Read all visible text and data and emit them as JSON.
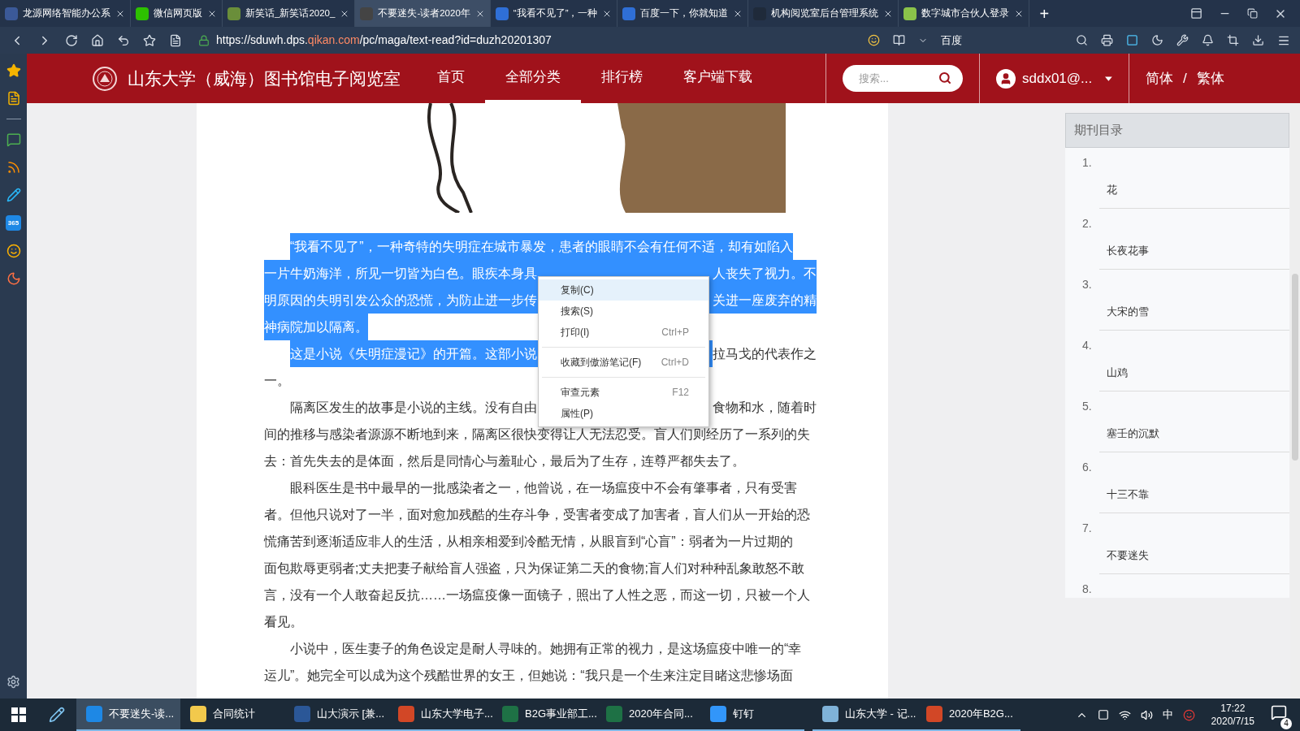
{
  "browser": {
    "tabs": [
      {
        "title": "龙源网络智能办公系",
        "selected": false,
        "color": "#3b5998"
      },
      {
        "title": "微信网页版",
        "selected": false,
        "color": "#2dc100"
      },
      {
        "title": "新笑话_新笑话2020_",
        "selected": false,
        "color": "#6a8e3a"
      },
      {
        "title": "不要迷失-读者2020年",
        "selected": true,
        "color": "#444444"
      },
      {
        "title": "“我看不见了”，一种",
        "selected": false,
        "color": "#2f6fd6"
      },
      {
        "title": "百度一下，你就知道",
        "selected": false,
        "color": "#2f6fd6"
      },
      {
        "title": "机构阅览室后台管理系统",
        "selected": false,
        "color": "#1f2a3a"
      },
      {
        "title": "数字城市合伙人登录",
        "selected": false,
        "color": "#8bc34a"
      }
    ],
    "new_tab": "+",
    "url": {
      "prefix": "https://sduwh.dps.",
      "domain": "qikan.com",
      "path": "/pc/maga/text-read?id=duzh20201307"
    },
    "search_engine": "百度"
  },
  "sidebar": {
    "badge_text": "365"
  },
  "header": {
    "title": "山东大学（威海）图书馆电子阅览室",
    "nav": [
      {
        "label": "首页",
        "selected": false
      },
      {
        "label": "全部分类",
        "selected": true
      },
      {
        "label": "排行榜",
        "selected": false
      },
      {
        "label": "客户端下载",
        "selected": false
      }
    ],
    "search": {
      "placeholder": "搜索..."
    },
    "user": "sddx01@...",
    "lang": {
      "simplified": "简体",
      "sep": "/",
      "traditional": "繁体"
    }
  },
  "article": {
    "paragraphs": [
      {
        "lines": [
          {
            "segments": [
              {
                "text": "“我看不见了”，一种奇特的失明症在城市暴发，患者的眼睛不会有任何不适，却有如陷入",
                "selected": true
              }
            ]
          },
          {
            "segments": [
              {
                "text": "一片牛奶海洋，所见一切皆为白色。眼疾本身具",
                "selected": true
              },
              {
                "text": "人丧失了视力。不",
                "selected": true
              }
            ]
          },
          {
            "segments": [
              {
                "text": "明原因的失明引发公众的恐慌，为防止进一步传",
                "selected": true
              },
              {
                "text": "关进一座废弃的精",
                "selected": true
              }
            ]
          },
          {
            "segments": [
              {
                "text": "神病院加以隔离。",
                "selected": true
              }
            ]
          }
        ]
      },
      {
        "lines": [
          {
            "segments": [
              {
                "text": "这是小说《失明症漫记》的开篇。这部小说",
                "selected": true
              },
              {
                "text": "拉马戈的代表作之",
                "selected": false
              }
            ]
          },
          {
            "segments": [
              {
                "text": "一。",
                "selected": false
              }
            ]
          }
        ]
      },
      {
        "lines": [
          {
            "segments": [
              {
                "text": "隔离区发生的故事是小说的主线。没有自由",
                "selected": false
              },
              {
                "text": "食物和水，随着时",
                "selected": false
              }
            ]
          },
          {
            "segments": [
              {
                "text": "间的推移与感染者源源不断地到来，隔离区很快变得让人无法忍受。盲人们则经历了一系列的失",
                "selected": false
              }
            ]
          },
          {
            "segments": [
              {
                "text": "去：首先失去的是体面，然后是同情心与羞耻心，最后为了生存，连尊严都失去了。",
                "selected": false
              }
            ]
          }
        ]
      },
      {
        "lines": [
          {
            "segments": [
              {
                "text": "眼科医生是书中最早的一批感染者之一，他曾说，在一场瘟疫中不会有肇事者，只有受害",
                "selected": false
              }
            ]
          },
          {
            "segments": [
              {
                "text": "者。但他只说对了一半，面对愈加残酷的生存斗争，受害者变成了加害者，盲人们从一开始的恐",
                "selected": false
              }
            ]
          },
          {
            "segments": [
              {
                "text": "慌痛苦到逐渐适应非人的生活，从相亲相爱到冷酷无情，从眼盲到“心盲”：弱者为一片过期的",
                "selected": false
              }
            ]
          },
          {
            "segments": [
              {
                "text": "面包欺辱更弱者;丈夫把妻子献给盲人强盗，只为保证第二天的食物;盲人们对种种乱象敢怒不敢",
                "selected": false
              }
            ]
          },
          {
            "segments": [
              {
                "text": "言，没有一个人敢奋起反抗……一场瘟疫像一面镜子，照出了人性之恶，而这一切，只被一个人",
                "selected": false
              }
            ]
          },
          {
            "segments": [
              {
                "text": "看见。",
                "selected": false
              }
            ]
          }
        ]
      },
      {
        "lines": [
          {
            "segments": [
              {
                "text": "小说中，医生妻子的角色设定是耐人寻味的。她拥有正常的视力，是这场瘟疫中唯一的“幸",
                "selected": false
              }
            ]
          },
          {
            "segments": [
              {
                "text": "运儿”。她完全可以成为这个残酷世界的女王，但她说：“我只是一个生来注定目睹这悲惨场面",
                "selected": false
              }
            ]
          }
        ]
      }
    ]
  },
  "context_menu": [
    {
      "kind": "item",
      "label": "复制(C)",
      "highlighted": true
    },
    {
      "kind": "item",
      "label": "搜索(S)",
      "highlighted": false
    },
    {
      "kind": "item",
      "label": "打印(I)",
      "shortcut": "Ctrl+P",
      "highlighted": false
    },
    {
      "kind": "separator"
    },
    {
      "kind": "item",
      "label": "收藏到傲游笔记(F)",
      "shortcut": "Ctrl+D",
      "highlighted": false
    },
    {
      "kind": "separator"
    },
    {
      "kind": "item",
      "label": "审查元素",
      "shortcut": "F12",
      "highlighted": false
    },
    {
      "kind": "item",
      "label": "属性(P)",
      "highlighted": false
    }
  ],
  "toc": {
    "title": "期刊目录",
    "items": [
      {
        "number": "1.",
        "title": "花"
      },
      {
        "number": "2.",
        "title": "长夜花事"
      },
      {
        "number": "3.",
        "title": "大宋的雪"
      },
      {
        "number": "4.",
        "title": "山鸡"
      },
      {
        "number": "5.",
        "title": "塞壬的沉默"
      },
      {
        "number": "6.",
        "title": "十三不靠"
      },
      {
        "number": "7.",
        "title": "不要迷失"
      },
      {
        "number": "8."
      }
    ]
  },
  "taskbar": {
    "apps": [
      {
        "label": "不要迷失-读...",
        "selected": true,
        "color": "#1e88e5"
      },
      {
        "label": "合同统计",
        "selected": false,
        "color": "#f2c94c"
      },
      {
        "label": "山大演示 [兼...",
        "selected": false,
        "color": "#2b5797"
      },
      {
        "label": "山东大学电子...",
        "selected": false,
        "color": "#d24726"
      },
      {
        "label": "B2G事业部工...",
        "selected": false,
        "color": "#1e7145"
      },
      {
        "label": "2020年合同...",
        "selected": false,
        "color": "#1e7145"
      },
      {
        "label": "钉钉",
        "selected": false,
        "color": "#3296fa"
      },
      {
        "label": "山东大学 - 记...",
        "selected": false,
        "color": "#7fb2d8"
      },
      {
        "label": "2020年B2G...",
        "selected": false,
        "color": "#d24726"
      }
    ],
    "ime": "中",
    "time": "17:22",
    "date": "2020/7/15",
    "notifications": "4"
  }
}
